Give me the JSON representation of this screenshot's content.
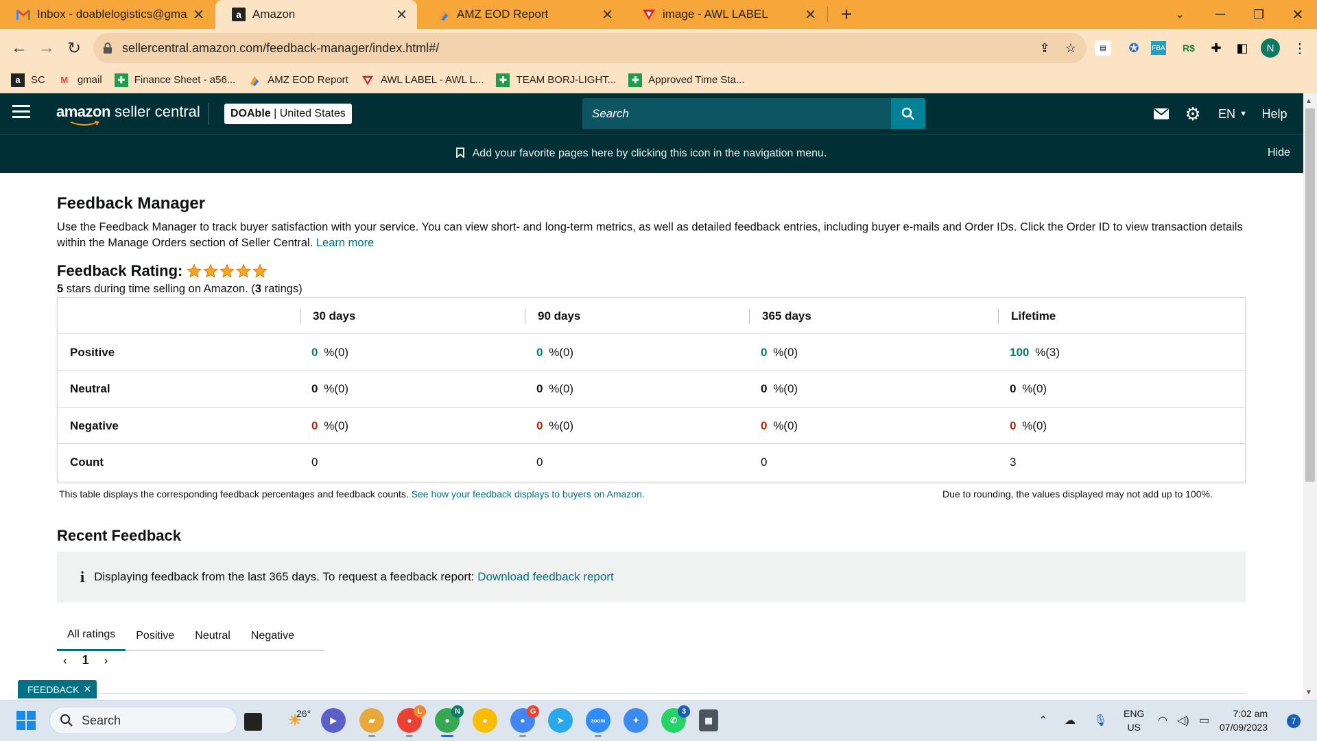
{
  "browser": {
    "tabs": [
      {
        "title": "Inbox - doablelogistics@gmail.com",
        "icon": "gmail-icon"
      },
      {
        "title": "Amazon",
        "icon": "amazon-icon"
      },
      {
        "title": "AMZ EOD Report",
        "icon": "sheets-icon"
      },
      {
        "title": "image - AWL LABEL",
        "icon": "awl-icon"
      }
    ],
    "url": "sellercentral.amazon.com/feedback-manager/index.html#/",
    "bookmarks": [
      {
        "label": "SC"
      },
      {
        "label": "gmail"
      },
      {
        "label": "Finance Sheet - a56..."
      },
      {
        "label": "AMZ EOD Report"
      },
      {
        "label": "AWL LABEL - AWL L..."
      },
      {
        "label": "TEAM BORJ-LIGHT..."
      },
      {
        "label": "Approved Time Sta..."
      }
    ],
    "profile_initial": "N"
  },
  "header": {
    "logo_bold": "amazon",
    "logo_rest": " seller central",
    "store_name": "DOAble",
    "store_sep": " | ",
    "store_region": "United States",
    "search_placeholder": "Search",
    "lang": "EN",
    "help": "Help",
    "favorites_text": "Add your favorite pages here by clicking this icon in the navigation menu.",
    "hide": "Hide"
  },
  "page": {
    "title": "Feedback Manager",
    "intro": "Use the Feedback Manager to track buyer satisfaction with your service. You can view short- and long-term metrics, as well as detailed feedback entries, including buyer e-mails and Order IDs. Click the Order ID to view transaction details within the Manage Orders section of Seller Central.",
    "learn_more": "Learn more",
    "rating_label": "Feedback Rating:",
    "rating_stars": 5,
    "summary_stars": "5",
    "summary_mid": " stars during time selling on Amazon. (",
    "summary_count": "3",
    "summary_end": " ratings)",
    "table_note": "This table displays the corresponding feedback percentages and feedback counts.",
    "table_note_link": "See how your feedback displays to buyers on Amazon.",
    "rounding_note": "Due to rounding, the values displayed may not add up to 100%.",
    "recent_title": "Recent Feedback",
    "info_text": "Displaying feedback from the last 365 days. To request a feedback report:",
    "info_link": "Download feedback report",
    "filter_tabs": [
      "All ratings",
      "Positive",
      "Neutral",
      "Negative"
    ],
    "page_number": "1",
    "feedback_pill": "FEEDBACK"
  },
  "feedback_table": {
    "columns": [
      "30 days",
      "90 days",
      "365 days",
      "Lifetime"
    ],
    "rows": [
      {
        "label": "Positive",
        "values": [
          [
            "0",
            " %(0)"
          ],
          [
            "0",
            " %(0)"
          ],
          [
            "0",
            " %(0)"
          ],
          [
            "100",
            " %(3)"
          ]
        ]
      },
      {
        "label": "Neutral",
        "values": [
          [
            "0",
            " %(0)"
          ],
          [
            "0",
            " %(0)"
          ],
          [
            "0",
            " %(0)"
          ],
          [
            "0",
            " %(0)"
          ]
        ]
      },
      {
        "label": "Negative",
        "values": [
          [
            "0",
            " %(0)"
          ],
          [
            "0",
            " %(0)"
          ],
          [
            "0",
            " %(0)"
          ],
          [
            "0",
            " %(0)"
          ]
        ]
      },
      {
        "label": "Count",
        "values": [
          [
            "",
            "0"
          ],
          [
            "",
            "0"
          ],
          [
            "",
            "0"
          ],
          [
            "",
            "3"
          ]
        ]
      }
    ]
  },
  "taskbar": {
    "search": "Search",
    "weather_temp": "26°",
    "whatsapp_badge": "3",
    "lang_line1": "ENG",
    "lang_line2": "US",
    "time": "7:02 am",
    "date": "07/09/2023",
    "notifications": "7"
  },
  "colors": {
    "chrome_tabstrip": "#f7a73a",
    "chrome_toolbar": "#fce3c3",
    "amazon_header": "#002f36",
    "link": "#007185",
    "positive": "#067d62",
    "negative": "#b12704",
    "star": "#ffa41c"
  }
}
